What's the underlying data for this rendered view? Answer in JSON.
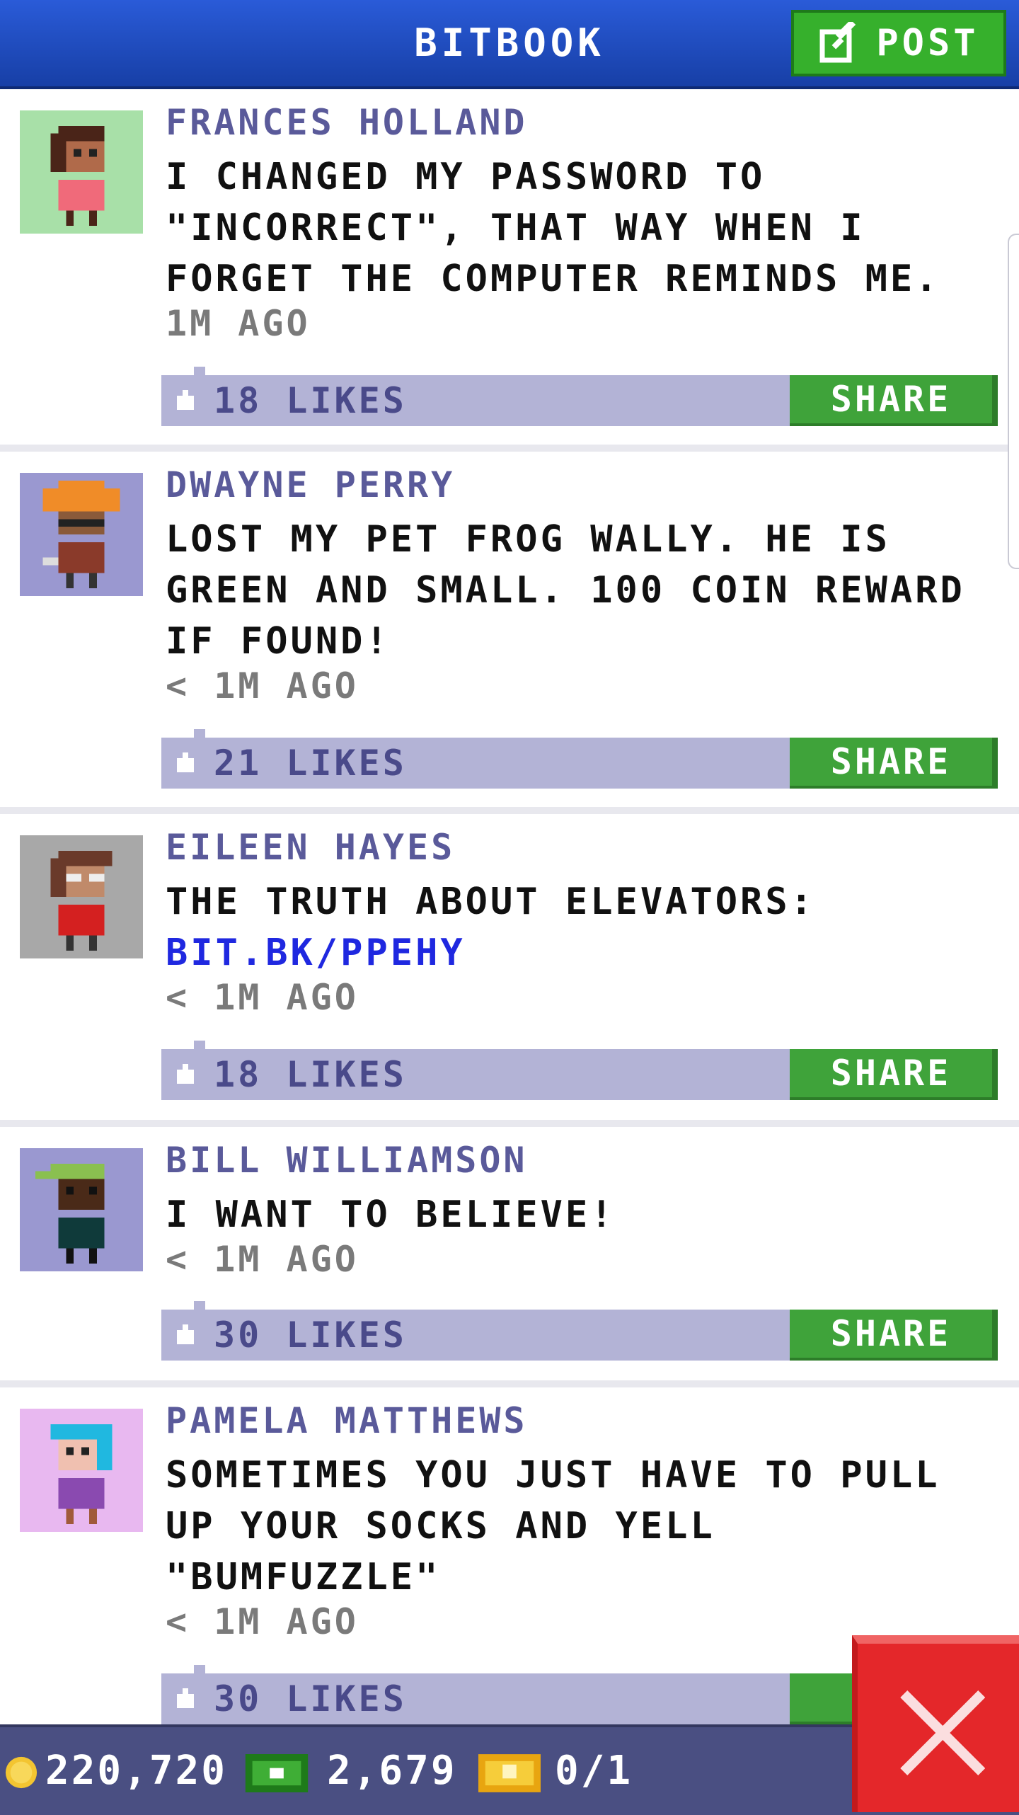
{
  "header": {
    "title": "BITBOOK",
    "post_label": "POST"
  },
  "posts": [
    {
      "name": "FRANCES HOLLAND",
      "text": "I CHANGED MY PASSWORD TO \"INCORRECT\", THAT WAY WHEN I FORGET THE COMPUTER REMINDS ME.",
      "link": "",
      "time": "1M AGO",
      "likes": "18 LIKES",
      "share": "SHARE",
      "avatar_bg": "#a8e0a8"
    },
    {
      "name": "DWAYNE PERRY",
      "text": "LOST MY PET FROG WALLY. HE IS GREEN AND SMALL. 100 COIN REWARD IF FOUND!",
      "link": "",
      "time": "< 1M AGO",
      "likes": "21 LIKES",
      "share": "SHARE",
      "avatar_bg": "#9a98d0"
    },
    {
      "name": "EILEEN HAYES",
      "text": "THE TRUTH ABOUT ELEVATORS:",
      "link": "BIT.BK/PPEHY",
      "time": "< 1M AGO",
      "likes": "18 LIKES",
      "share": "SHARE",
      "avatar_bg": "#a8a8a8"
    },
    {
      "name": "BILL WILLIAMSON",
      "text": "I WANT TO BELIEVE!",
      "link": "",
      "time": "< 1M AGO",
      "likes": "30 LIKES",
      "share": "SHARE",
      "avatar_bg": "#9a98d0"
    },
    {
      "name": "PAMELA MATTHEWS",
      "text": "SOMETIMES YOU JUST HAVE TO PULL UP YOUR SOCKS AND YELL \"BUMFUZZLE\"",
      "link": "",
      "time": "< 1M AGO",
      "likes": "30 LIKES",
      "share": "S",
      "avatar_bg": "#e8b8f0"
    }
  ],
  "status": {
    "coins": "220,720",
    "bux": "2,679",
    "tickets": "0/1"
  },
  "colors": {
    "header": "#2a5bd8",
    "accent_green": "#36b02c",
    "likes_bar": "#b3b3d6",
    "close": "#e4272a"
  },
  "icons": {
    "post": "edit-icon",
    "like": "thumb-up-icon",
    "coin": "coin-icon",
    "bux": "bux-icon",
    "ticket": "ticket-icon",
    "close": "close-icon"
  }
}
